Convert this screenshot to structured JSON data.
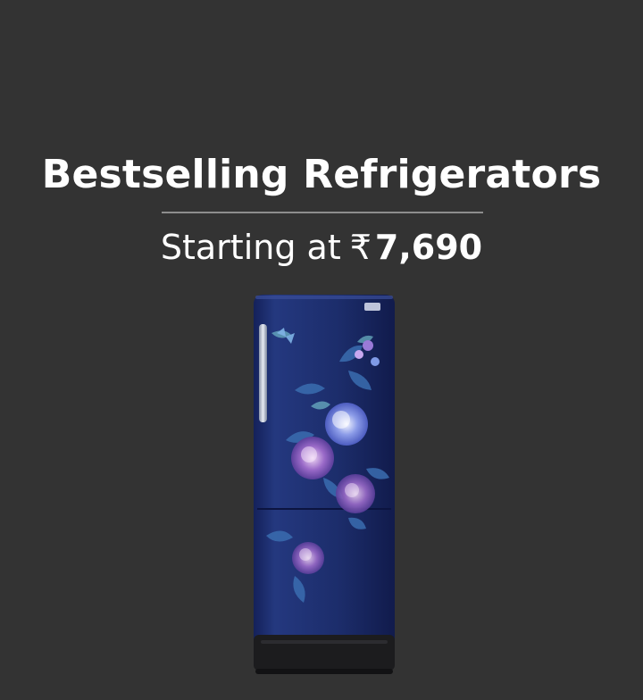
{
  "banner": {
    "headline": "Bestselling Refrigerators",
    "subline_text": "Starting at",
    "currency_symbol": "₹",
    "price": "7,690"
  },
  "image": {
    "product": "refrigerator-floral-icon"
  },
  "colors": {
    "background": "#333333",
    "text": "#ffffff",
    "divider": "#8d8d8d",
    "fridge_body": "#1e2f6e"
  }
}
